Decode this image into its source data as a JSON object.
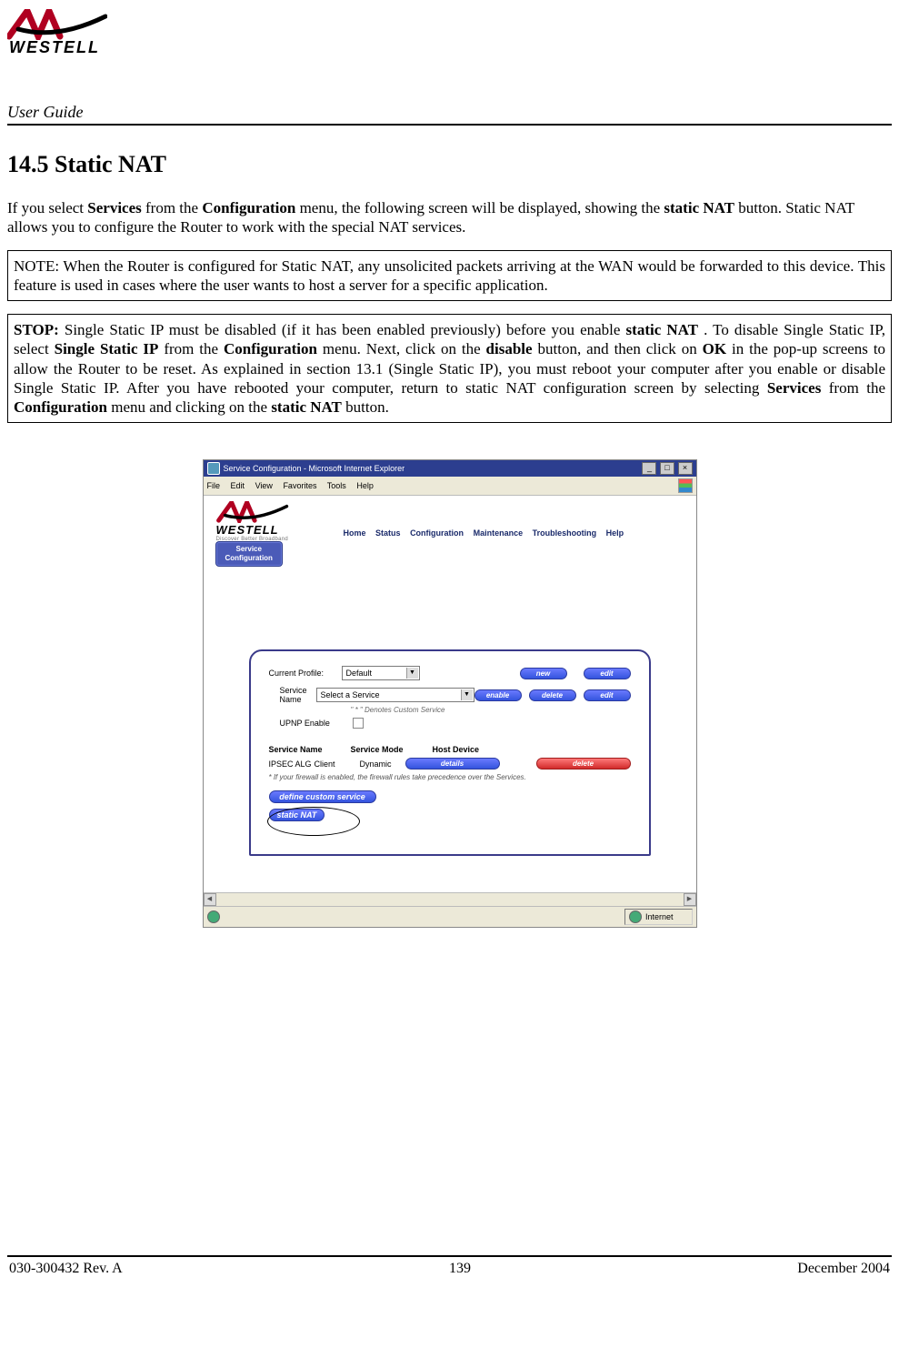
{
  "header": {
    "logo_text": "WESTELL",
    "title": "User Guide"
  },
  "section": {
    "heading": "14.5 Static NAT",
    "intro": {
      "pre": "If you select ",
      "b1": "Services",
      "mid1": " from the ",
      "b2": "Configuration",
      "mid2": " menu, the following screen will be displayed, showing the ",
      "b3": "static NAT",
      "post": " button. Static NAT allows you to configure the Router to work with the special NAT services."
    },
    "note": "NOTE: When the Router is configured for Static NAT, any unsolicited packets arriving at the WAN would be forwarded to this device. This feature is used in cases where the user wants to host a server for a specific application.",
    "stop": {
      "lead": "STOP:",
      "t1": " Single Static IP must be disabled (if it has been enabled previously) before you enable ",
      "b1": "static NAT",
      "t2": ". To disable Single Static IP, select ",
      "b2": "Single Static IP",
      "t3": " from the ",
      "b3": "Configuration",
      "t4": " menu. Next, click on the ",
      "b4": "disable",
      "t5": " button, and then click on ",
      "b5": "OK",
      "t6": " in the pop-up screens to allow the Router to be reset. As explained in section 13.1 (Single Static IP), you must reboot your computer after you enable or disable Single Static IP. After you have rebooted your computer, return to static NAT configuration screen by selecting ",
      "b6": "Services",
      "t7": " from the ",
      "b7": "Configuration",
      "t8": " menu and clicking on the ",
      "b8": "static NAT",
      "t9": " button."
    }
  },
  "mock": {
    "window_title": "Service Configuration - Microsoft Internet Explorer",
    "menubar": {
      "file": "File",
      "edit": "Edit",
      "view": "View",
      "favorites": "Favorites",
      "tools": "Tools",
      "help": "Help"
    },
    "logo": {
      "name": "WESTELL",
      "tag": "Discover Better Broadband"
    },
    "nav": {
      "home": "Home",
      "status": "Status",
      "configuration": "Configuration",
      "maintenance": "Maintenance",
      "troubleshooting": "Troubleshooting",
      "help": "Help"
    },
    "crumb": {
      "line1": "Service",
      "line2": "Configuration"
    },
    "panel": {
      "current_profile_lbl": "Current Profile:",
      "current_profile_val": "Default",
      "btn_new": "new",
      "btn_edit": "edit",
      "service_name_lbl": "Service Name",
      "service_name_val": "Select a Service",
      "btn_enable": "enable",
      "btn_delete": "delete",
      "btn_edit2": "edit",
      "custom_note": "\" * \" Denotes Custom Service",
      "upnp_lbl": "UPNP Enable",
      "tbl": {
        "h1": "Service Name",
        "h2": "Service Mode",
        "h3": "Host Device",
        "r1c1": "IPSEC ALG",
        "r1c2": "Client",
        "r1c3": "Dynamic",
        "btn_details": "details",
        "btn_delete": "delete"
      },
      "fw_note": "* If your firewall is enabled, the firewall rules take precedence over the Services.",
      "btn_define": "define custom service",
      "btn_static": "static NAT"
    },
    "status": {
      "zone": "Internet"
    }
  },
  "footer": {
    "left": "030-300432 Rev. A",
    "center": "139",
    "right": "December 2004"
  }
}
